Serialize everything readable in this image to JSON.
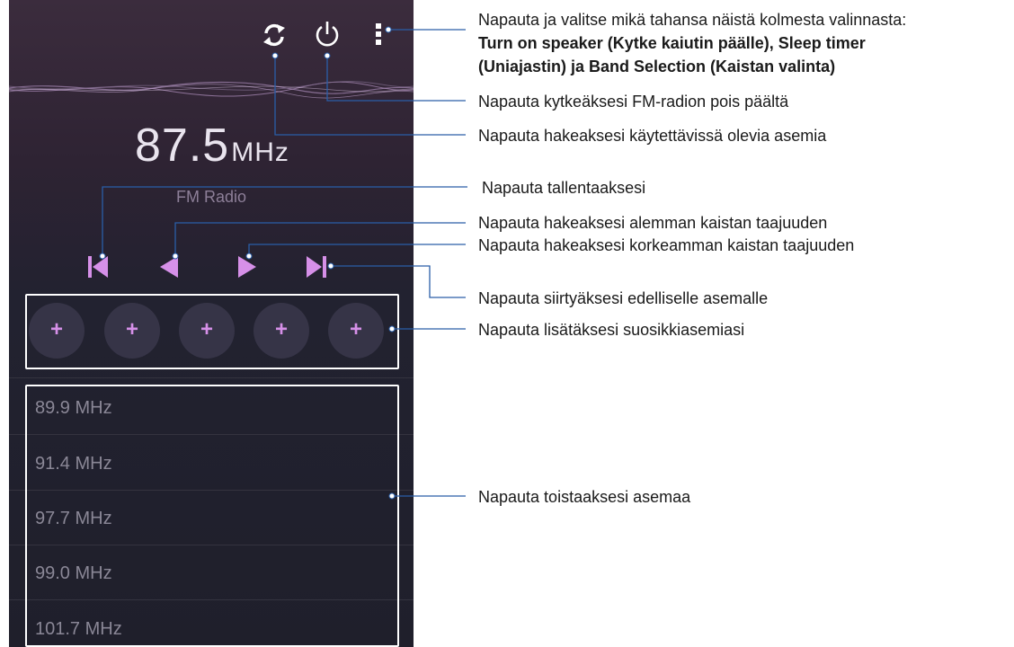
{
  "player": {
    "frequency_value": "87.5",
    "frequency_unit": "MHz",
    "band_label": "FM Radio"
  },
  "favorites": [
    {
      "label": "+"
    },
    {
      "label": "+"
    },
    {
      "label": "+"
    },
    {
      "label": "+"
    },
    {
      "label": "+"
    }
  ],
  "stations": [
    {
      "label": "89.9 MHz"
    },
    {
      "label": "91.4 MHz"
    },
    {
      "label": "97.7 MHz"
    },
    {
      "label": "99.0 MHz"
    },
    {
      "label": "101.7 MHz"
    }
  ],
  "callouts": {
    "menu_line1": "Napauta ja valitse mikä tahansa näistä kolmesta valinnasta:",
    "menu_line2": "Turn on speaker (Kytke kaiutin päälle), Sleep timer",
    "menu_line3": "(Uniajastin) ja Band Selection (Kaistan valinta)",
    "power": "Napauta kytkeäksesi FM-radion pois päältä",
    "refresh": "Napauta hakeaksesi käytettävissä olevia asemia",
    "record": "Napauta tallentaaksesi",
    "lower": "Napauta hakeaksesi alemman kaistan taajuuden",
    "higher": "Napauta hakeaksesi korkeamman kaistan taajuuden",
    "previous": "Napauta siirtyäksesi edelliselle asemalle",
    "favorites": "Napauta lisätäksesi suosikkiasemiasi",
    "play": "Napauta toistaaksesi asemaa"
  },
  "colors": {
    "accent": "#d690e8",
    "wave": "#9a7ea8",
    "leader_line": "#2a5ea8"
  },
  "icons": [
    "refresh-icon",
    "power-icon",
    "more-menu-icon",
    "skip-back-icon",
    "seek-down-icon",
    "seek-up-icon",
    "skip-forward-icon"
  ]
}
